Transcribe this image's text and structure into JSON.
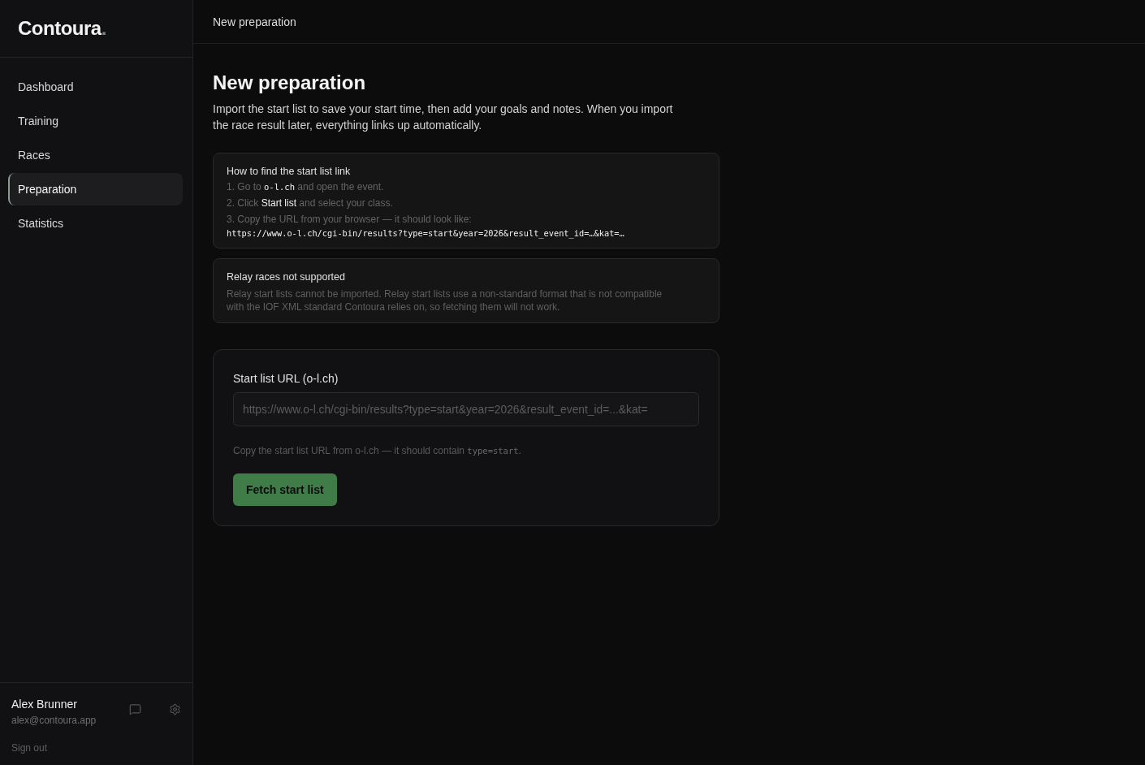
{
  "sidebar": {
    "logo": {
      "name": "Contoura",
      "mark": "."
    },
    "nav": [
      {
        "label": "Dashboard",
        "selected": false
      },
      {
        "label": "Training",
        "selected": false
      },
      {
        "label": "Races",
        "selected": false
      },
      {
        "label": "Preparation",
        "selected": true
      },
      {
        "label": "Statistics",
        "selected": false
      }
    ],
    "user": {
      "name": "Alex Brunner",
      "email": "alex@contoura.app",
      "sign_out": "Sign out"
    }
  },
  "header": {
    "title": "New preparation"
  },
  "page": {
    "title": "New preparation",
    "description": "Import the start list to save your start time, then add your goals and notes. When you import the race result later, everything links up automatically."
  },
  "info_cards": [
    {
      "kind": "steps",
      "title": "How to find the start list link",
      "steps": [
        {
          "parts": [
            {
              "kind": "text",
              "text": "1. Go to "
            },
            {
              "kind": "code",
              "text": "o-l.ch"
            },
            {
              "kind": "text",
              "text": " and open the event."
            }
          ]
        },
        {
          "parts": [
            {
              "kind": "text",
              "text": "2. Click "
            },
            {
              "kind": "strong",
              "text": "Start list"
            },
            {
              "kind": "text",
              "text": " and select your class."
            }
          ]
        },
        {
          "parts": [
            {
              "kind": "text",
              "text": "3. Copy the URL from your browser — it should look like:"
            }
          ]
        }
      ],
      "example_url": "https://www.o-l.ch/cgi-bin/results?type=start&year=2026&result_event_id=…&kat=…"
    },
    {
      "kind": "notice",
      "title": "Relay races not supported",
      "body": "Relay start lists cannot be imported. Relay start lists use a non-standard format that is not compatible with the IOF XML standard Contoura relies on, so fetching them will not work."
    }
  ],
  "form": {
    "label": "Start list URL (o-l.ch)",
    "placeholder": "https://www.o-l.ch/cgi-bin/results?type=start&year=2026&result_event_id=...&kat=",
    "hint": [
      {
        "kind": "text",
        "text": "Copy the start list URL from o-l.ch — it should contain "
      },
      {
        "kind": "code",
        "text": "type=start"
      },
      {
        "kind": "text",
        "text": "."
      }
    ],
    "button": "Fetch start list"
  }
}
